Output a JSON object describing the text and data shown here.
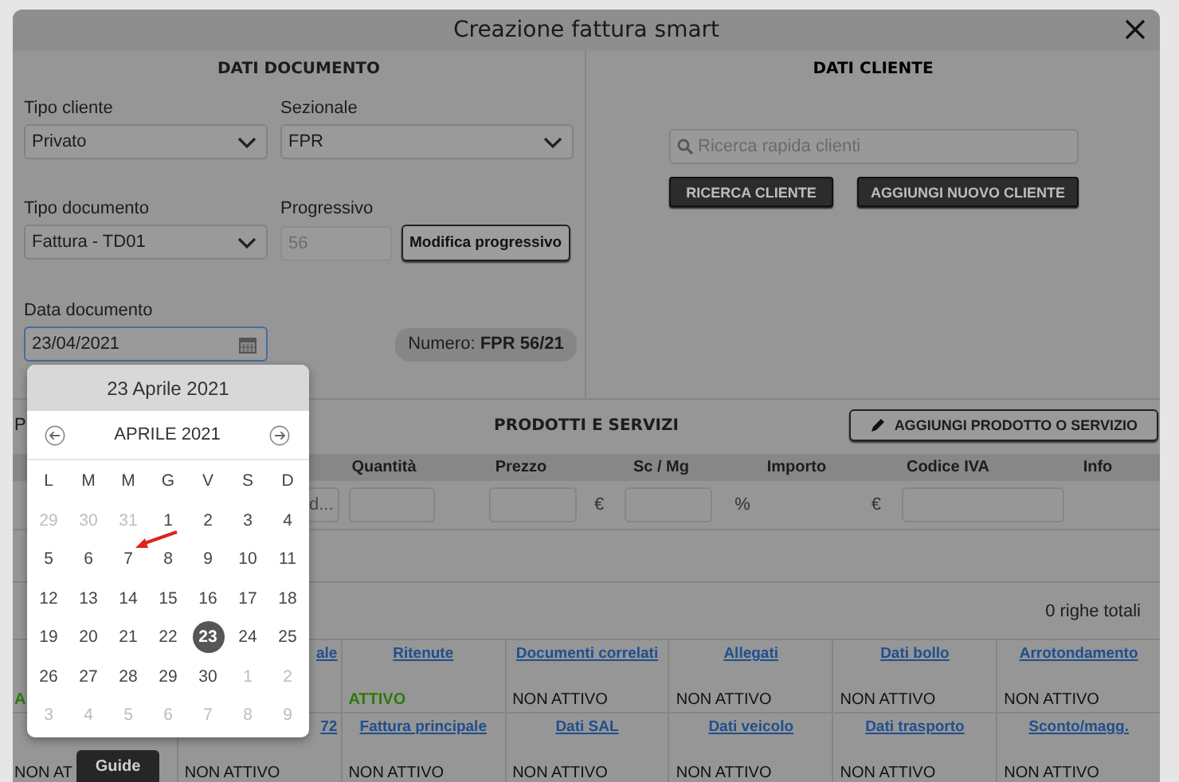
{
  "window": {
    "title": "Creazione fattura smart"
  },
  "document": {
    "heading": "DATI DOCUMENTO",
    "tipo_cliente": {
      "label": "Tipo cliente",
      "value": "Privato"
    },
    "sezionale": {
      "label": "Sezionale",
      "value": "FPR"
    },
    "tipo_documento": {
      "label": "Tipo documento",
      "value": "Fattura - TD01"
    },
    "progressivo": {
      "label": "Progressivo",
      "value": "56",
      "disabled": true
    },
    "modify_button": "Modifica progressivo",
    "data_documento": {
      "label": "Data documento",
      "value": "23/04/2021",
      "focused": true
    },
    "numero": "Numero: **FPR 56/21**"
  },
  "client": {
    "heading": "DATI CLIENTE",
    "search": {
      "placeholder": "Ricerca rapida clienti"
    },
    "buttons": [
      "RICERCA CLIENTE",
      "AGGIUNGI NUOVO CLIENTE"
    ]
  },
  "products": {
    "label": "P",
    "heading": "PRODOTTI E SERVIZI",
    "add_button": "AGGIUNGI PRODOTTO O SERVIZIO",
    "columns": [
      "Quantità",
      "Prezzo",
      "Sc / Mg",
      "Importo",
      "Codice IVA",
      "Info"
    ],
    "input_row": [
      {
        "kind": "field",
        "placeholder": "d..."
      },
      {
        "kind": "field"
      },
      {
        "kind": "field"
      },
      {
        "kind": "unit",
        "text": "€"
      },
      {
        "kind": "field"
      },
      {
        "kind": "unit",
        "text": "%"
      },
      {
        "kind": "unit",
        "text": "€"
      },
      {
        "kind": "field"
      }
    ],
    "total": "0 righe totali"
  },
  "features": [
    [
      {
        "status": "A",
        "active": true
      },
      {
        "title": "ale",
        "kind": "fragment"
      },
      {
        "title": "Ritenute",
        "status": "ATTIVO",
        "active": true
      },
      {
        "title": "Documenti correlati",
        "status": "NON ATTIVO",
        "active": false
      },
      {
        "title": "Allegati",
        "status": "NON ATTIVO",
        "active": false
      },
      {
        "title": "Dati bollo",
        "status": "NON ATTIVO",
        "active": false
      },
      {
        "title": "Arrotondamento",
        "status": "NON ATTIVO",
        "active": false
      }
    ],
    [
      {
        "status": "NON AT",
        "active": false
      },
      {
        "title": "72",
        "kind": "fragment",
        "status": "NON ATTIVO",
        "active": false
      },
      {
        "title": "Fattura principale",
        "status": "NON ATTIVO",
        "active": false
      },
      {
        "title": "Dati SAL",
        "status": "NON ATTIVO",
        "active": false
      },
      {
        "title": "Dati veicolo",
        "status": "NON ATTIVO",
        "active": false
      },
      {
        "title": "Dati trasporto",
        "status": "NON ATTIVO",
        "active": false
      },
      {
        "title": "Sconto/magg.",
        "status": "NON ATTIVO",
        "active": false
      }
    ]
  ],
  "calendar": {
    "selected_date": "23 Aprile 2021",
    "month": "APRILE 2021",
    "weekdays": [
      "L",
      "M",
      "M",
      "G",
      "V",
      "S",
      "D"
    ],
    "days": [
      {
        "label": "29",
        "muted": true,
        "selected": false
      },
      {
        "label": "30",
        "muted": true,
        "selected": false
      },
      {
        "label": "31",
        "muted": true,
        "selected": false
      },
      {
        "label": "1",
        "muted": false,
        "selected": false
      },
      {
        "label": "2",
        "muted": false,
        "selected": false
      },
      {
        "label": "3",
        "muted": false,
        "selected": false
      },
      {
        "label": "4",
        "muted": false,
        "selected": false
      },
      {
        "label": "5",
        "muted": false,
        "selected": false
      },
      {
        "label": "6",
        "muted": false,
        "selected": false
      },
      {
        "label": "7",
        "muted": false,
        "selected": false
      },
      {
        "label": "8",
        "muted": false,
        "selected": false
      },
      {
        "label": "9",
        "muted": false,
        "selected": false
      },
      {
        "label": "10",
        "muted": false,
        "selected": false
      },
      {
        "label": "11",
        "muted": false,
        "selected": false
      },
      {
        "label": "12",
        "muted": false,
        "selected": false
      },
      {
        "label": "13",
        "muted": false,
        "selected": false
      },
      {
        "label": "14",
        "muted": false,
        "selected": false
      },
      {
        "label": "15",
        "muted": false,
        "selected": false
      },
      {
        "label": "16",
        "muted": false,
        "selected": false
      },
      {
        "label": "17",
        "muted": false,
        "selected": false
      },
      {
        "label": "18",
        "muted": false,
        "selected": false
      },
      {
        "label": "19",
        "muted": false,
        "selected": false
      },
      {
        "label": "20",
        "muted": false,
        "selected": false
      },
      {
        "label": "21",
        "muted": false,
        "selected": false
      },
      {
        "label": "22",
        "muted": false,
        "selected": false
      },
      {
        "label": "23",
        "muted": false,
        "selected": true
      },
      {
        "label": "24",
        "muted": false,
        "selected": false
      },
      {
        "label": "25",
        "muted": false,
        "selected": false
      },
      {
        "label": "26",
        "muted": false,
        "selected": false
      },
      {
        "label": "27",
        "muted": false,
        "selected": false
      },
      {
        "label": "28",
        "muted": false,
        "selected": false
      },
      {
        "label": "29",
        "muted": false,
        "selected": false
      },
      {
        "label": "30",
        "muted": false,
        "selected": false
      },
      {
        "label": "1",
        "muted": true,
        "selected": false
      },
      {
        "label": "2",
        "muted": true,
        "selected": false
      },
      {
        "label": "3",
        "muted": true,
        "selected": false
      },
      {
        "label": "4",
        "muted": true,
        "selected": false
      },
      {
        "label": "5",
        "muted": true,
        "selected": false
      },
      {
        "label": "6",
        "muted": true,
        "selected": false
      },
      {
        "label": "7",
        "muted": true,
        "selected": false
      },
      {
        "label": "8",
        "muted": true,
        "selected": false
      },
      {
        "label": "9",
        "muted": true,
        "selected": false
      }
    ]
  },
  "guide_tab": "Guide"
}
